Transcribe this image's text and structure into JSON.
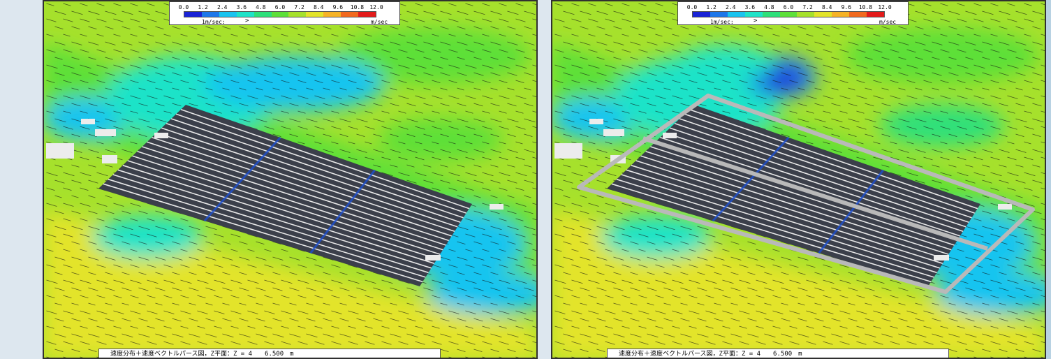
{
  "legend": {
    "ticks": [
      "0.0",
      "1.2",
      "2.4",
      "3.6",
      "4.8",
      "6.0",
      "7.2",
      "8.4",
      "9.6",
      "10.8",
      "12.0"
    ],
    "colors": [
      "#1a23d6",
      "#1d77ea",
      "#19c4f0",
      "#1fe3c8",
      "#2ee07a",
      "#5de039",
      "#a6e12c",
      "#e3e42a",
      "#f6b326",
      "#f26a1f",
      "#e41b1b"
    ],
    "scale_label": "1m/sec:",
    "arrow": ">",
    "unit": "m/sec"
  },
  "caption": "速度分布＋速度ベクトルパース図，Z平面：Z = 4　　6.500　m",
  "panels": [
    {
      "name": "without-fence",
      "fence": false
    },
    {
      "name": "with-fence",
      "fence": true
    }
  ]
}
